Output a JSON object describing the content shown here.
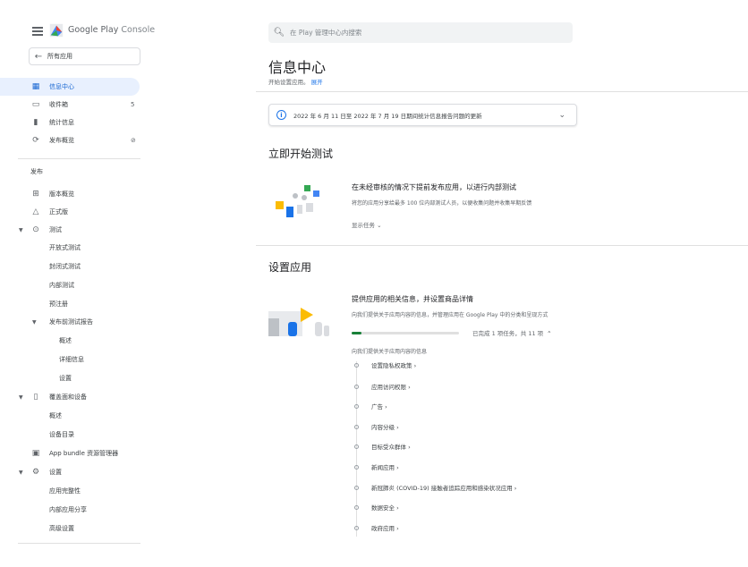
{
  "brand": {
    "name": "Google Play",
    "suffix": "Console"
  },
  "sidebar": {
    "all_apps": "所有应用",
    "top_items": [
      {
        "label": "信息中心",
        "icon": "dashboard-icon",
        "active": true
      },
      {
        "label": "收件箱",
        "icon": "inbox-icon",
        "badge": "5"
      },
      {
        "label": "统计信息",
        "icon": "bar-chart-icon"
      },
      {
        "label": "发布概览",
        "icon": "publish-overview-icon",
        "badge_icon": "sync-off-icon"
      }
    ],
    "section_release": "发布",
    "release_items": {
      "versions": "版本概览",
      "production": "正式版",
      "testing": "测试",
      "open_testing": "开放式测试",
      "closed_testing": "封闭式测试",
      "internal_testing": "内部测试",
      "pre_registration": "预注册",
      "prelaunch_report": "发布前测试报告",
      "overview": "概述",
      "details": "详细信息",
      "settings": "设置",
      "reach_devices": "覆盖面和设备",
      "reach_overview": "概述",
      "device_catalog": "设备目录",
      "bundle_explorer": "App bundle 资源管理器",
      "setup": "设置",
      "app_integrity": "应用完整性",
      "internal_sharing": "内部应用分享",
      "advanced_settings": "高级设置"
    }
  },
  "search": {
    "placeholder": "在 Play 管理中心内搜索"
  },
  "page": {
    "title": "信息中心",
    "subtitle": "开始设置应用。",
    "expand": "展开"
  },
  "notice": {
    "text": "2022 年 6 月 11 日至 2022 年 7 月 19 日期间统计信息报告问题的更新"
  },
  "testing_section": {
    "heading": "立即开始测试",
    "title": "在未经审核的情况下提前发布应用，以进行内部测试",
    "desc": "将您的应用分享给最多 100 位内部测试人员，以便收集问题并收集早期反馈",
    "show_tasks": "显示任务"
  },
  "setup_section": {
    "heading": "设置应用",
    "title": "提供应用的相关信息，并设置商品详情",
    "desc": "向我们提供关于应用内容的信息，并管理应用在 Google Play 中的分类和呈现方式",
    "progress_text": "已完成 1 项任务，共 11 项",
    "progress_fraction": 0.09,
    "tasks_head": "向我们提供关于应用内容的信息",
    "tasks": [
      "设置隐私权政策 ›",
      "应用访问权限 ›",
      "广告 ›",
      "内容分级 ›",
      "目标受众群体 ›",
      "新闻应用 ›",
      "新冠肺炎 (COVID-19) 接触者追踪应用和感染状况应用 ›",
      "数据安全 ›",
      "政府应用 ›"
    ]
  },
  "colors": {
    "accent": "#1a73e8",
    "active_bg": "#e8f0fe",
    "progress": "#188038"
  }
}
